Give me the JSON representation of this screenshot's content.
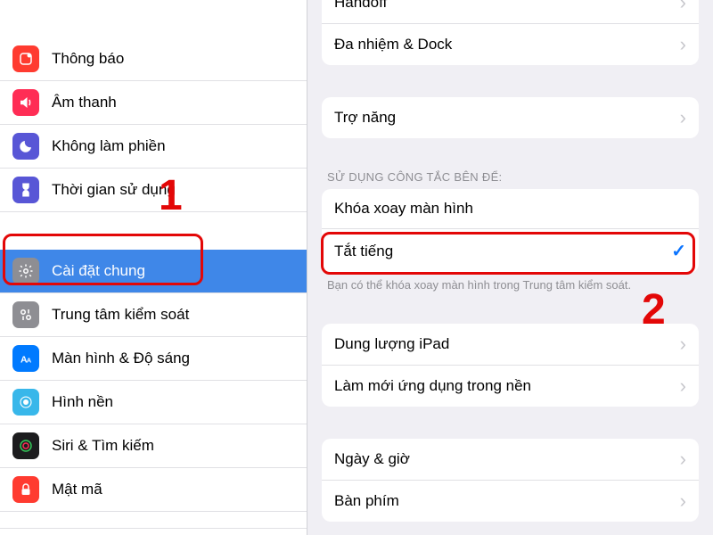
{
  "sidebar": {
    "group1": [
      {
        "label": "Thông báo",
        "icon": "notification-icon",
        "bg": "#ff3b30"
      },
      {
        "label": "Âm thanh",
        "icon": "sound-icon",
        "bg": "#ff2d55"
      },
      {
        "label": "Không làm phiền",
        "icon": "do-not-disturb-icon",
        "bg": "#5856d6"
      },
      {
        "label": "Thời gian sử dụng",
        "icon": "screen-time-icon",
        "bg": "#5856d6"
      }
    ],
    "group2": [
      {
        "label": "Cài đặt chung",
        "icon": "gear-icon",
        "bg": "#8e8e93",
        "selected": true
      },
      {
        "label": "Trung tâm kiểm soát",
        "icon": "control-center-icon",
        "bg": "#8e8e93"
      },
      {
        "label": "Màn hình & Độ sáng",
        "icon": "display-icon",
        "bg": "#007aff"
      },
      {
        "label": "Hình nền",
        "icon": "wallpaper-icon",
        "bg": "#38b7ea"
      },
      {
        "label": "Siri & Tìm kiếm",
        "icon": "siri-icon",
        "bg": "#1c1c1e"
      },
      {
        "label": "Mật mã",
        "icon": "passcode-icon",
        "bg": "#ff3b30"
      }
    ]
  },
  "detail": {
    "sec1": [
      {
        "label": "Handoff",
        "chevron": true
      },
      {
        "label": "Đa nhiệm & Dock",
        "chevron": true
      }
    ],
    "sec2": [
      {
        "label": "Trợ năng",
        "chevron": true
      }
    ],
    "sec3_header": "SỬ DỤNG CÔNG TẮC BÊN ĐỂ:",
    "sec3": [
      {
        "label": "Khóa xoay màn hình",
        "check": false
      },
      {
        "label": "Tắt tiếng",
        "check": true
      }
    ],
    "sec3_footer": "Bạn có thể khóa xoay màn hình trong Trung tâm kiểm soát.",
    "sec4": [
      {
        "label": "Dung lượng iPad",
        "chevron": true
      },
      {
        "label": "Làm mới ứng dụng trong nền",
        "chevron": true
      }
    ],
    "sec5": [
      {
        "label": "Ngày & giờ",
        "chevron": true
      },
      {
        "label": "Bàn phím",
        "chevron": true
      }
    ]
  },
  "glyphs": {
    "chevron": "›",
    "check": "✓"
  },
  "annotations": {
    "n1": "1",
    "n2": "2"
  }
}
